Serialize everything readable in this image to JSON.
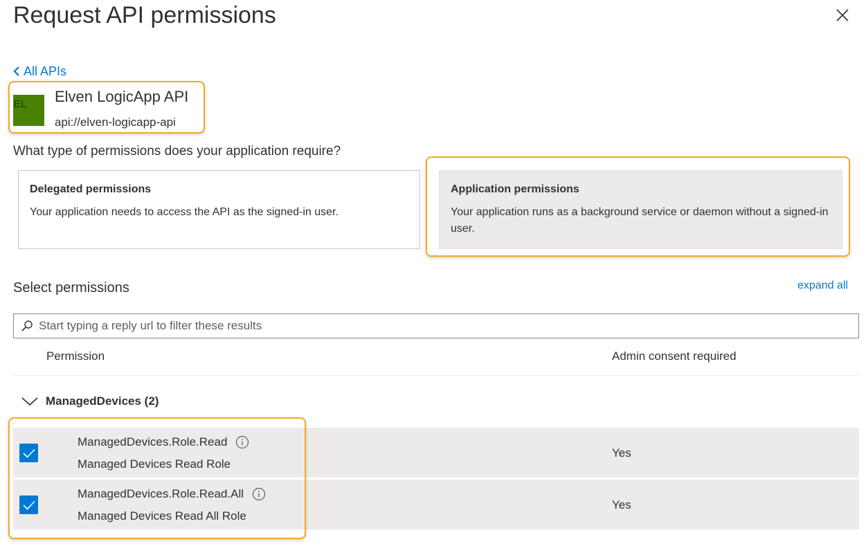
{
  "panel": {
    "title": "Request API permissions"
  },
  "nav": {
    "back_label": "All APIs"
  },
  "api": {
    "logo_text": "EL",
    "name": "Elven LogicApp API",
    "identifier": "api://elven-logicapp-api",
    "logo_color": "#498205"
  },
  "permission_type": {
    "question": "What type of permissions does your application require?",
    "options": [
      {
        "title": "Delegated permissions",
        "description": "Your application needs to access the API as the signed-in user.",
        "selected": false
      },
      {
        "title": "Application permissions",
        "description": "Your application runs as a background service or daemon without a signed-in user.",
        "selected": true
      }
    ]
  },
  "select_permissions": {
    "title": "Select permissions",
    "expand_all_label": "expand all",
    "search_placeholder": "Start typing a reply url to filter these results",
    "search_value": "",
    "columns": {
      "permission": "Permission",
      "admin_consent": "Admin consent required"
    },
    "groups": [
      {
        "label": "ManagedDevices (2)",
        "expanded": true,
        "permissions": [
          {
            "name": "ManagedDevices.Role.Read",
            "description": "Managed Devices Read Role",
            "admin_consent": "Yes",
            "checked": true
          },
          {
            "name": "ManagedDevices.Role.Read.All",
            "description": "Managed Devices Read All Role",
            "admin_consent": "Yes",
            "checked": true
          }
        ]
      }
    ]
  },
  "colors": {
    "accent": "#0078d4",
    "highlight": "#f0ac1a",
    "selected_background": "#edebe9"
  }
}
